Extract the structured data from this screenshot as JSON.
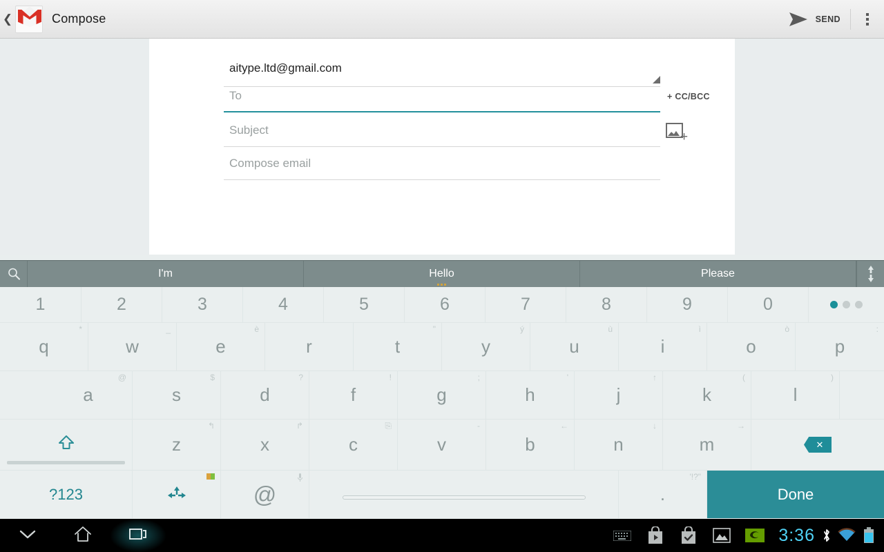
{
  "actionbar": {
    "back_icon": "back-chevron-icon",
    "app_icon": "gmail-logo-icon",
    "title": "Compose",
    "send_icon": "send-arrow-icon",
    "send_label": "SEND",
    "overflow_icon": "overflow-menu-icon"
  },
  "compose": {
    "from_value": "aitype.ltd@gmail.com",
    "from_dropdown_icon": "expand-corner-icon",
    "to_placeholder": "To",
    "to_value": "",
    "subject_placeholder": "Subject",
    "subject_value": "",
    "body_placeholder": "Compose email",
    "body_value": "",
    "ccbcc_label": "+ CC/BCC",
    "attach_icon": "add-image-icon",
    "focus_color": "#22909c"
  },
  "suggestions": {
    "search_icon": "search-icon",
    "expand_icon": "expand-suggestions-icon",
    "items": [
      {
        "text": "I'm",
        "has_dots": false
      },
      {
        "text": "Hello",
        "has_dots": true
      },
      {
        "text": "Please",
        "has_dots": false
      }
    ],
    "dots_color": "#d2a23c",
    "bar_color": "#7d8c8c"
  },
  "keyboard": {
    "accent_color": "#22868f",
    "rows": {
      "numbers": [
        {
          "label": "1"
        },
        {
          "label": "2"
        },
        {
          "label": "3"
        },
        {
          "label": "4"
        },
        {
          "label": "5"
        },
        {
          "label": "6"
        },
        {
          "label": "7"
        },
        {
          "label": "8"
        },
        {
          "label": "9"
        },
        {
          "label": "0"
        }
      ],
      "numbers_pager": {
        "name": "page-indicator",
        "pages": 3,
        "active": 1
      },
      "qwerty": [
        {
          "label": "q",
          "hint": "*"
        },
        {
          "label": "w",
          "hint": "_"
        },
        {
          "label": "e",
          "hint": "è"
        },
        {
          "label": "r",
          "hint": ""
        },
        {
          "label": "t",
          "hint": "\""
        },
        {
          "label": "y",
          "hint": "ý"
        },
        {
          "label": "u",
          "hint": "ù"
        },
        {
          "label": "i",
          "hint": "ì"
        },
        {
          "label": "o",
          "hint": "ò"
        },
        {
          "label": "p",
          "hint": ":"
        }
      ],
      "home": [
        {
          "label": "a",
          "hint": "@"
        },
        {
          "label": "s",
          "hint": "$"
        },
        {
          "label": "d",
          "hint": "?"
        },
        {
          "label": "f",
          "hint": "!"
        },
        {
          "label": "g",
          "hint": ";"
        },
        {
          "label": "h",
          "hint": "'"
        },
        {
          "label": "j",
          "hint": "↑"
        },
        {
          "label": "k",
          "hint": "("
        },
        {
          "label": "l",
          "hint": ")"
        }
      ],
      "bottom_letters": [
        {
          "label": "z",
          "hint": "↰"
        },
        {
          "label": "x",
          "hint": "↱"
        },
        {
          "label": "c",
          "hint": "⎘"
        },
        {
          "label": "v",
          "hint": "-"
        },
        {
          "label": "b",
          "hint": "←"
        },
        {
          "label": "n",
          "hint": "↓"
        },
        {
          "label": "m",
          "hint": "→"
        }
      ],
      "shift_key": {
        "name": "shift-key",
        "icon": "shift-arrow-icon"
      },
      "backspace_key": {
        "name": "backspace-key",
        "icon": "backspace-icon"
      },
      "symbols_key": {
        "label": "?123"
      },
      "arrows_key": {
        "name": "cursor-arrows-key",
        "icon": "arrow-cluster-icon",
        "hint": "keyboard-switch-icon"
      },
      "at_key": {
        "label": "@",
        "hint": "mic-icon"
      },
      "space_key": {
        "name": "space-key",
        "label": ""
      },
      "period_key": {
        "label": ".",
        "hint": "'!?\""
      },
      "done_key": {
        "label": "Done"
      }
    }
  },
  "navbar": {
    "hide_keyboard_icon": "chevron-down-icon",
    "home_icon": "home-icon",
    "recents_icon": "recents-icon",
    "status": {
      "keyboard_icon": "keyboard-indicator-icon",
      "play_store_icon": "play-store-icon",
      "play_check_icon": "app-installed-icon",
      "screenshot_icon": "screenshot-image-icon",
      "nvidia_icon": "nvidia-logo-icon",
      "clock": "3:36",
      "bluetooth_icon": "bluetooth-icon",
      "wifi_icon": "wifi-icon",
      "battery_icon": "battery-icon",
      "clock_color": "#4fd2f5"
    }
  }
}
